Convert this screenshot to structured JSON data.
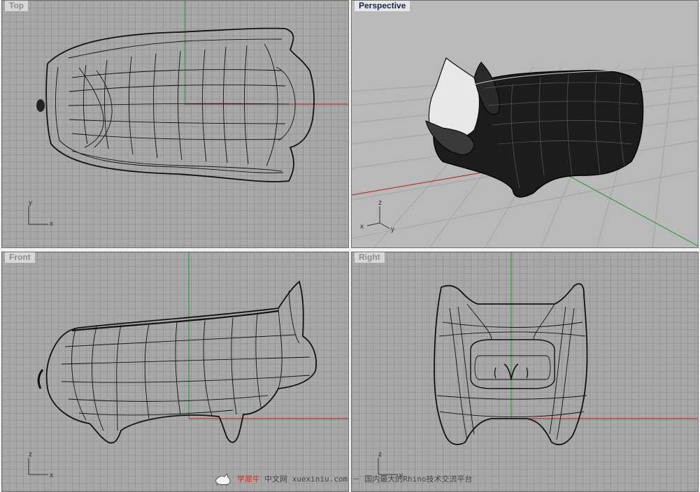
{
  "viewports": {
    "top": {
      "label": "Top",
      "axes": [
        "y",
        "x"
      ]
    },
    "perspective": {
      "label": "Perspective",
      "axes": [
        "z",
        "x",
        "y"
      ]
    },
    "front": {
      "label": "Front",
      "axes": [
        "z",
        "x"
      ]
    },
    "right": {
      "label": "Right",
      "axes": [
        "z",
        "y"
      ]
    }
  },
  "active_viewport": "perspective",
  "watermark": {
    "brand": "学犀牛",
    "text": "中文网 xuexiniu.com － 国内最大的Rhino技术交流平台",
    "icon": "rhino-logo-icon"
  },
  "colors": {
    "viewport_bg": "#a8a8a8",
    "grid_line": "#979797",
    "x_axis": "#b01d1d",
    "y_axis": "#1e9a2a",
    "wire": "#111111",
    "active_tab_text": "#20233a"
  }
}
